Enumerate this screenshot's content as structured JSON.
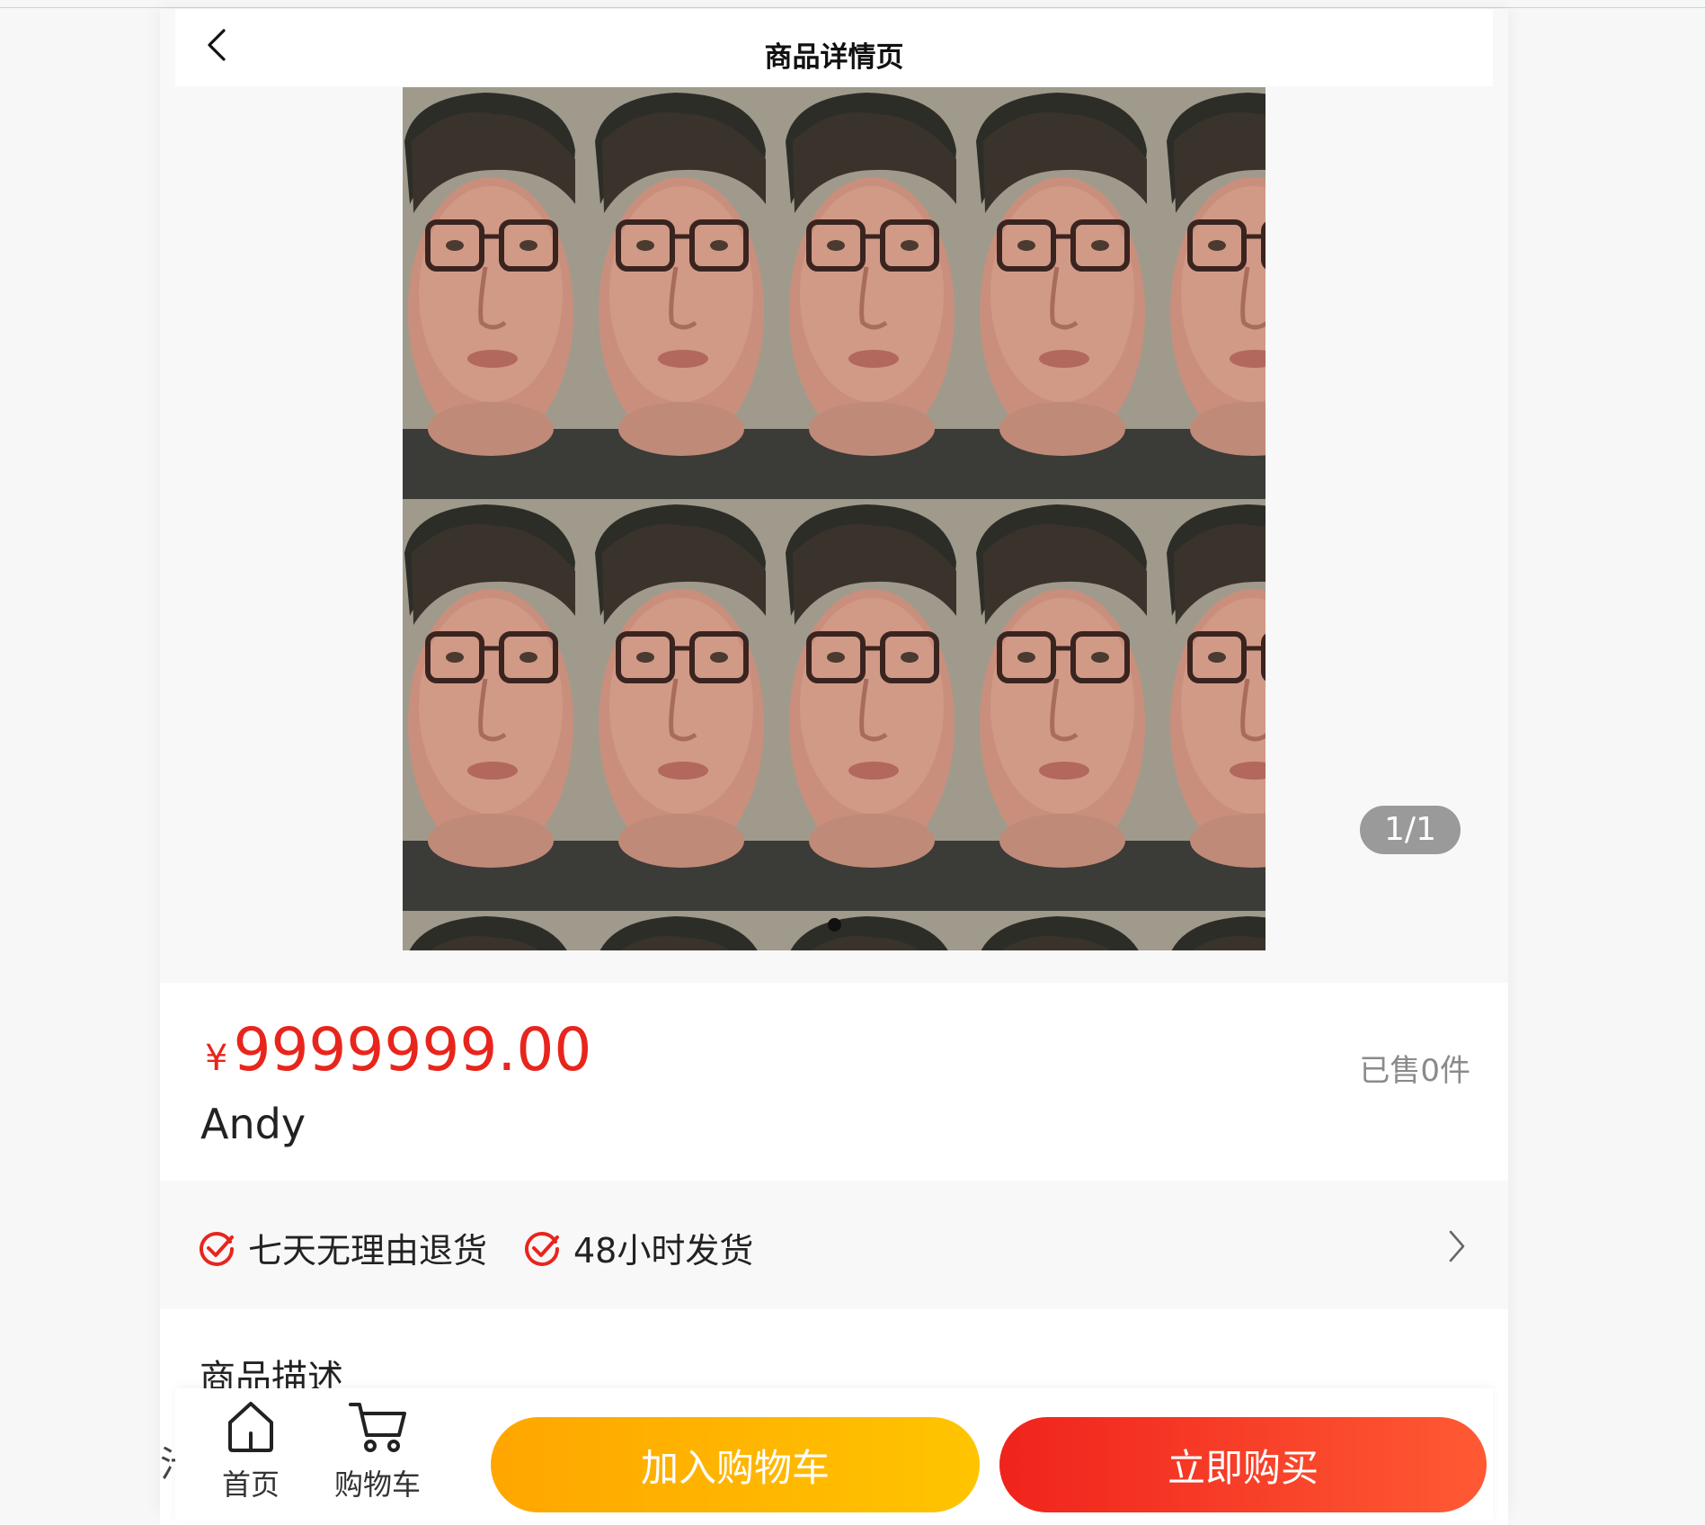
{
  "navbar": {
    "title": "商品详情页",
    "back_icon": "chevron-left-icon"
  },
  "gallery": {
    "counter": "1/1",
    "current_index": 1,
    "total": 1
  },
  "product": {
    "currency": "¥",
    "price": "9999999.00",
    "sold": "已售0件",
    "name": "Andy"
  },
  "services": {
    "items": [
      {
        "label": "七天无理由退货",
        "icon": "check-circle-icon"
      },
      {
        "label": "48小时发货",
        "icon": "check-circle-icon"
      }
    ],
    "more_icon": "chevron-right-icon"
  },
  "description": {
    "title": "商品描述",
    "peek_text": "汁"
  },
  "tabbar": {
    "home_label": "首页",
    "cart_label": "购物车",
    "add_to_cart_label": "加入购物车",
    "buy_now_label": "立即购买"
  },
  "colors": {
    "price": "#e8251d",
    "check": "#e8251d",
    "add_to_cart": "#ffb300",
    "buy_now": "#f0231c"
  }
}
